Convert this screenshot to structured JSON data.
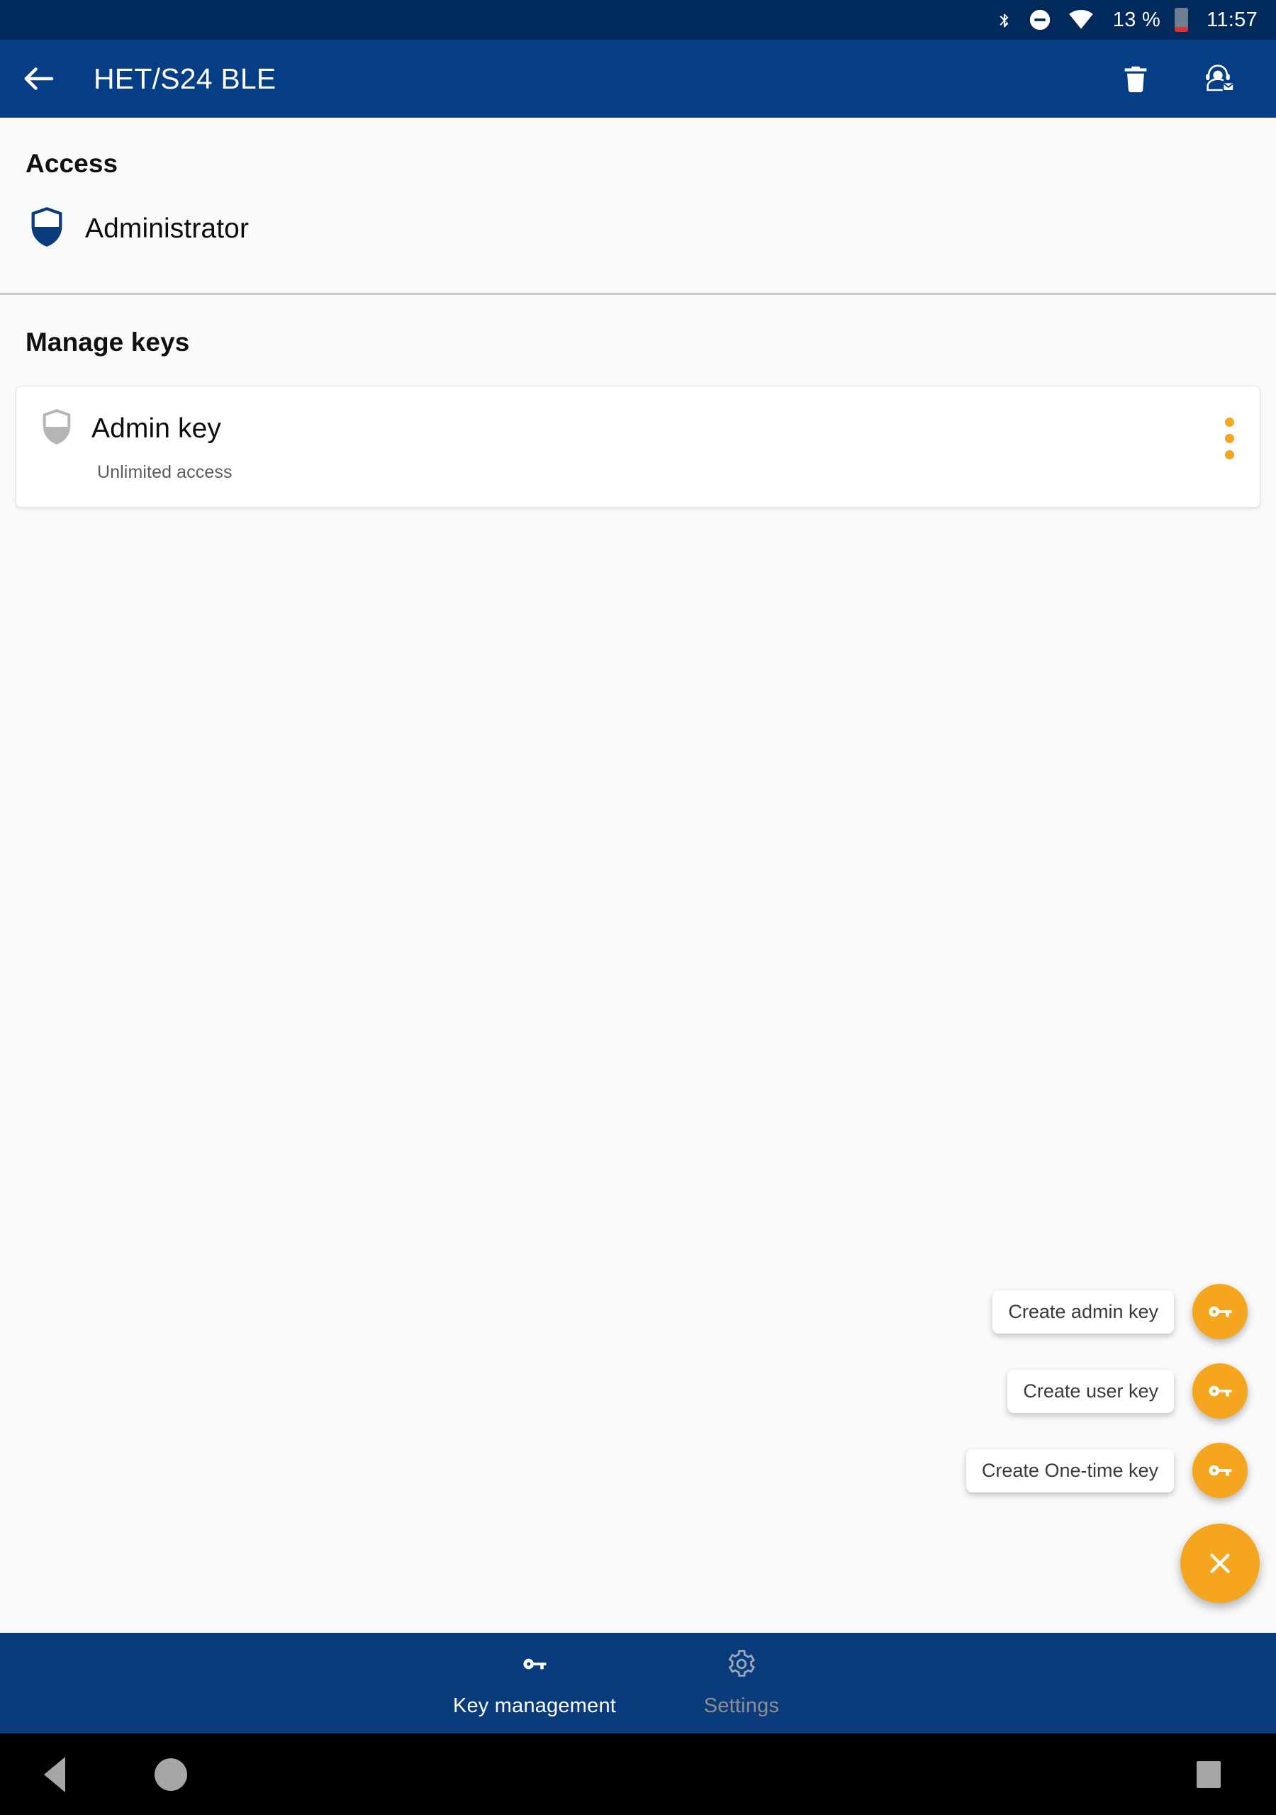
{
  "statusbar": {
    "bluetooth_icon": "bluetooth-icon",
    "dnd_icon": "do-not-disturb-icon",
    "wifi_icon": "wifi-icon",
    "battery_percent": "13 %",
    "battery_icon": "battery-low-icon",
    "battery_level": 13,
    "time": "11:57",
    "bg_color": "#002A5C"
  },
  "appbar": {
    "back_icon": "back-arrow-icon",
    "title": "HET/S24 BLE",
    "delete_icon": "delete-trash-icon",
    "support_icon": "contact-support-icon",
    "bg_color": "#063E85"
  },
  "access": {
    "section_title": "Access",
    "role_icon": "shield-admin-icon",
    "role_label": "Administrator"
  },
  "manage_keys": {
    "section_title": "Manage keys",
    "cards": [
      {
        "icon": "shield-key-icon",
        "title": "Admin key",
        "subtitle": "Unlimited access",
        "menu_icon": "overflow-menu-icon"
      }
    ]
  },
  "speed_dial": {
    "accent_color": "#F5A61E",
    "actions": [
      {
        "label": "Create admin key",
        "icon": "key-icon"
      },
      {
        "label": "Create user key",
        "icon": "key-icon"
      },
      {
        "label": "Create One-time key",
        "icon": "key-icon"
      }
    ],
    "main_icon": "close-x-icon"
  },
  "bottom_nav": {
    "bg_color": "#0A3C7D",
    "items": [
      {
        "label": "Key management",
        "icon": "key-icon",
        "active": true
      },
      {
        "label": "Settings",
        "icon": "gear-icon",
        "active": false
      }
    ]
  },
  "system_nav": {
    "back_icon": "system-back-icon",
    "home_icon": "system-home-icon",
    "recents_icon": "system-recents-icon"
  }
}
